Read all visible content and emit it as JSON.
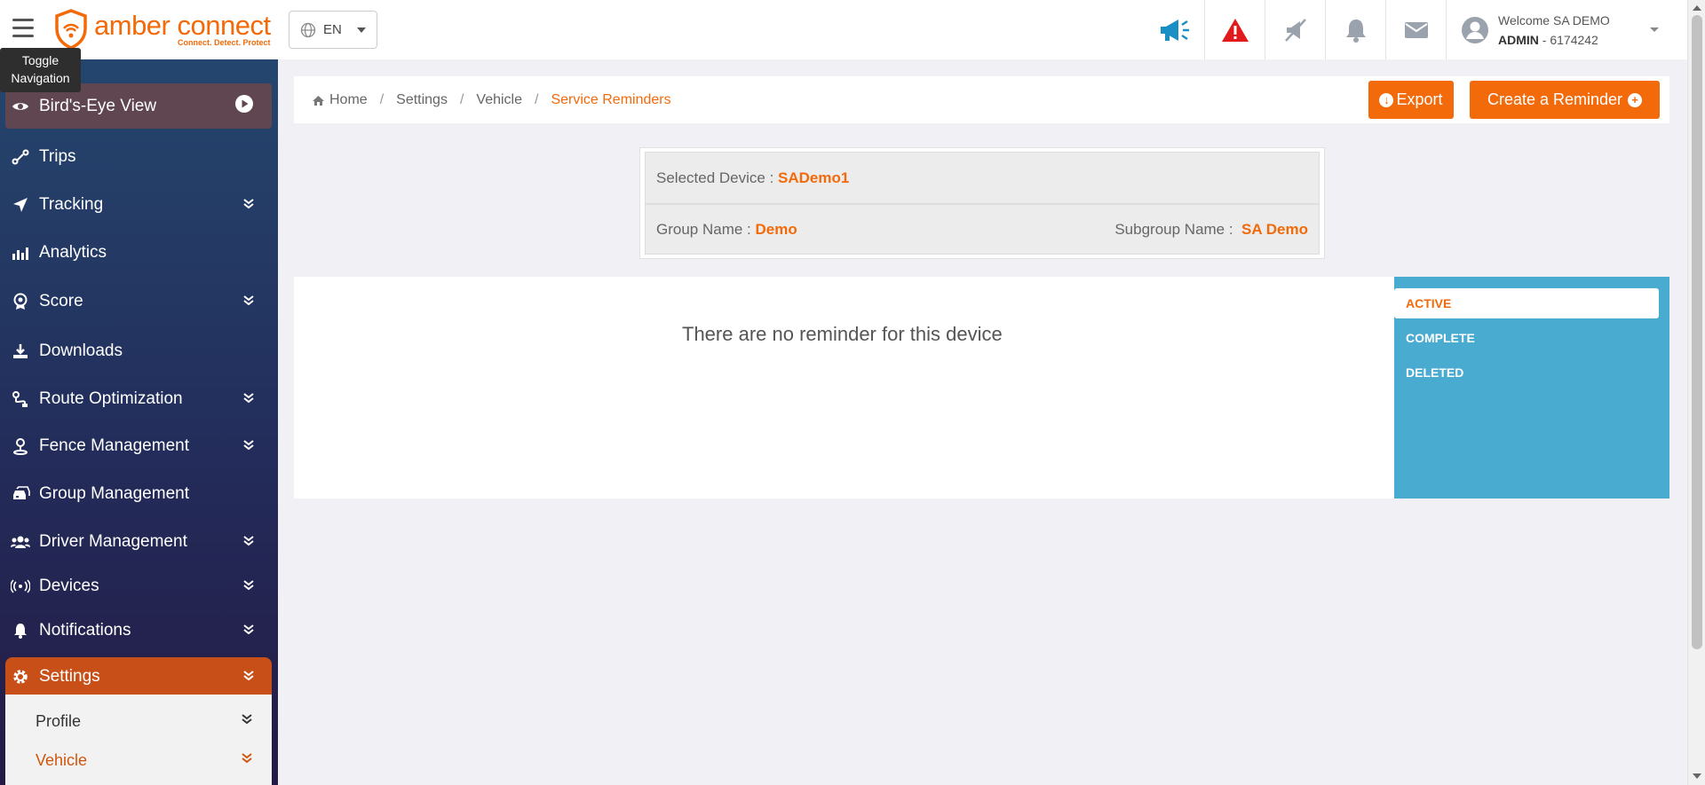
{
  "app": {
    "logo_main": "amber connect",
    "logo_tagline": "Connect. Detect. Protect",
    "language": "EN",
    "tooltip": "Toggle Navigation"
  },
  "header": {
    "welcome": "Welcome SA DEMO",
    "role": "ADMIN",
    "account": " - 6174242",
    "icons": [
      "megaphone-icon",
      "alert-triangle-icon",
      "muted-megaphone-icon",
      "bell-icon",
      "mail-icon"
    ]
  },
  "sidebar": {
    "items": [
      {
        "label": "Bird's-Eye View",
        "icon": "eye-icon"
      },
      {
        "label": "Trips",
        "icon": "route-icon"
      },
      {
        "label": "Tracking",
        "icon": "location-arrow-icon"
      },
      {
        "label": "Analytics",
        "icon": "analytics-icon"
      },
      {
        "label": "Score",
        "icon": "award-icon"
      },
      {
        "label": "Downloads",
        "icon": "download-icon"
      },
      {
        "label": "Route Optimization",
        "icon": "route-optimization-icon"
      },
      {
        "label": "Fence Management",
        "icon": "geofence-icon"
      },
      {
        "label": "Group Management",
        "icon": "car-group-icon"
      },
      {
        "label": "Driver Management",
        "icon": "users-icon"
      },
      {
        "label": "Devices",
        "icon": "broadcast-icon"
      },
      {
        "label": "Notifications",
        "icon": "bell-icon"
      },
      {
        "label": "Settings",
        "icon": "gear-icon"
      }
    ],
    "settings_sub": [
      {
        "label": "Profile"
      },
      {
        "label": "Vehicle"
      }
    ]
  },
  "breadcrumb": {
    "home": "Home",
    "settings": "Settings",
    "vehicle": "Vehicle",
    "current": "Service Reminders"
  },
  "actions": {
    "export": "Export",
    "create": "Create a Reminder"
  },
  "device": {
    "selected_label": "Selected Device : ",
    "selected_value": "SADemo1",
    "group_label": "Group Name : ",
    "group_value": "Demo",
    "subgroup_label": "Subgroup Name : ",
    "subgroup_value": "SA Demo"
  },
  "content": {
    "empty_message": "There are no reminder for this device"
  },
  "tabs": [
    {
      "label": "ACTIVE"
    },
    {
      "label": "COMPLETE"
    },
    {
      "label": "DELETED"
    }
  ],
  "colors": {
    "accent": "#f26a0a",
    "tab_panel": "#4aabd1",
    "megaphone": "#1a8fc4",
    "alert": "#e11b1b"
  }
}
